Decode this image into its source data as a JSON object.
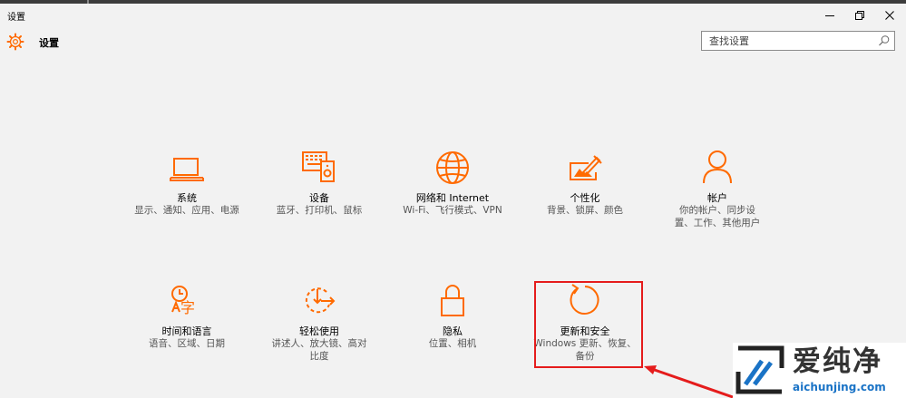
{
  "window": {
    "title": "设置"
  },
  "header": {
    "app_title": "设置"
  },
  "search": {
    "placeholder": "查找设置"
  },
  "accent_color": "#ff6a00",
  "tiles": [
    {
      "icon": "laptop-icon",
      "label": "系统",
      "desc": "显示、通知、应用、电源"
    },
    {
      "icon": "devices-icon",
      "label": "设备",
      "desc": "蓝牙、打印机、鼠标"
    },
    {
      "icon": "globe-icon",
      "label": "网络和 Internet",
      "desc": "Wi-Fi、飞行模式、VPN"
    },
    {
      "icon": "personalization-icon",
      "label": "个性化",
      "desc": "背景、锁屏、颜色"
    },
    {
      "icon": "person-icon",
      "label": "帐户",
      "desc": "你的帐户、同步设置、工作、其他用户"
    },
    {
      "icon": "time-language-icon",
      "label": "时间和语言",
      "desc": "语音、区域、日期"
    },
    {
      "icon": "ease-of-access-icon",
      "label": "轻松使用",
      "desc": "讲述人、放大镜、高对比度"
    },
    {
      "icon": "lock-icon",
      "label": "隐私",
      "desc": "位置、相机"
    },
    {
      "icon": "refresh-icon",
      "label": "更新和安全",
      "desc": "Windows 更新、恢复、备份"
    }
  ],
  "watermark": {
    "title": "爱纯净",
    "url": "aichunjing.com"
  },
  "annotation_color": "#e51c1c"
}
